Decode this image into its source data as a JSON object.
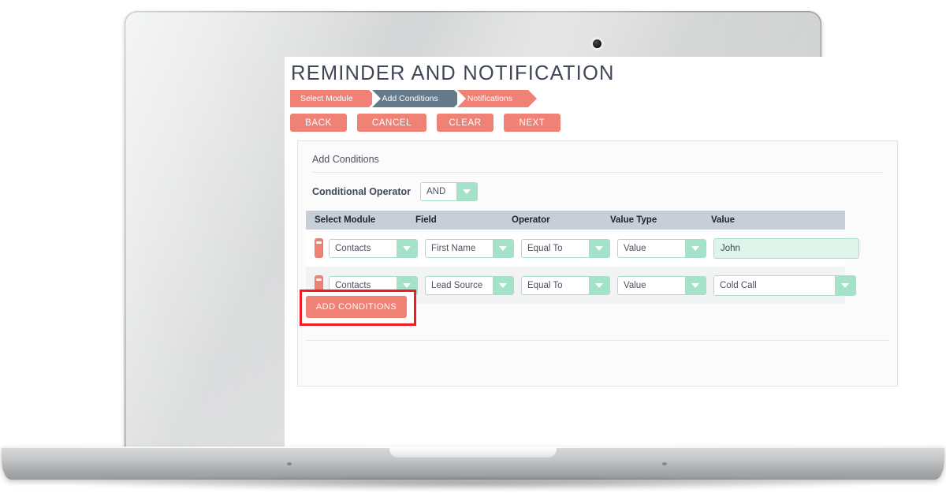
{
  "page": {
    "title": "REMINDER AND NOTIFICATION"
  },
  "steps": [
    {
      "label": "Select Module",
      "state": "done"
    },
    {
      "label": "Add Conditions",
      "state": "active"
    },
    {
      "label": "Notifications",
      "state": "pending"
    }
  ],
  "toolbar": {
    "back_label": "BACK",
    "cancel_label": "CANCEL",
    "clear_label": "CLEAR",
    "next_label": "NEXT"
  },
  "card": {
    "heading": "Add Conditions",
    "conditional_operator_label": "Conditional Operator",
    "conditional_operator_value": "AND",
    "add_conditions_label": "ADD CONDITIONS"
  },
  "table": {
    "headers": [
      "Select Module",
      "Field",
      "Operator",
      "Value Type",
      "Value"
    ],
    "rows": [
      {
        "module": "Contacts",
        "field": "First Name",
        "operator": "Equal To",
        "value_type": "Value",
        "value": "John",
        "value_control": "text"
      },
      {
        "module": "Contacts",
        "field": "Lead Source",
        "operator": "Equal To",
        "value_type": "Value",
        "value": "Cold Call",
        "value_control": "select"
      }
    ]
  },
  "colors": {
    "salmon": "#ef8275",
    "slate": "#64798a",
    "mint": "#a4e3ca",
    "mint_border": "#a9ddcb",
    "mint_fill": "#dff5ec",
    "table_header": "#c7ced6",
    "highlight_red": "#ee1c25",
    "title_text": "#3f4758"
  }
}
